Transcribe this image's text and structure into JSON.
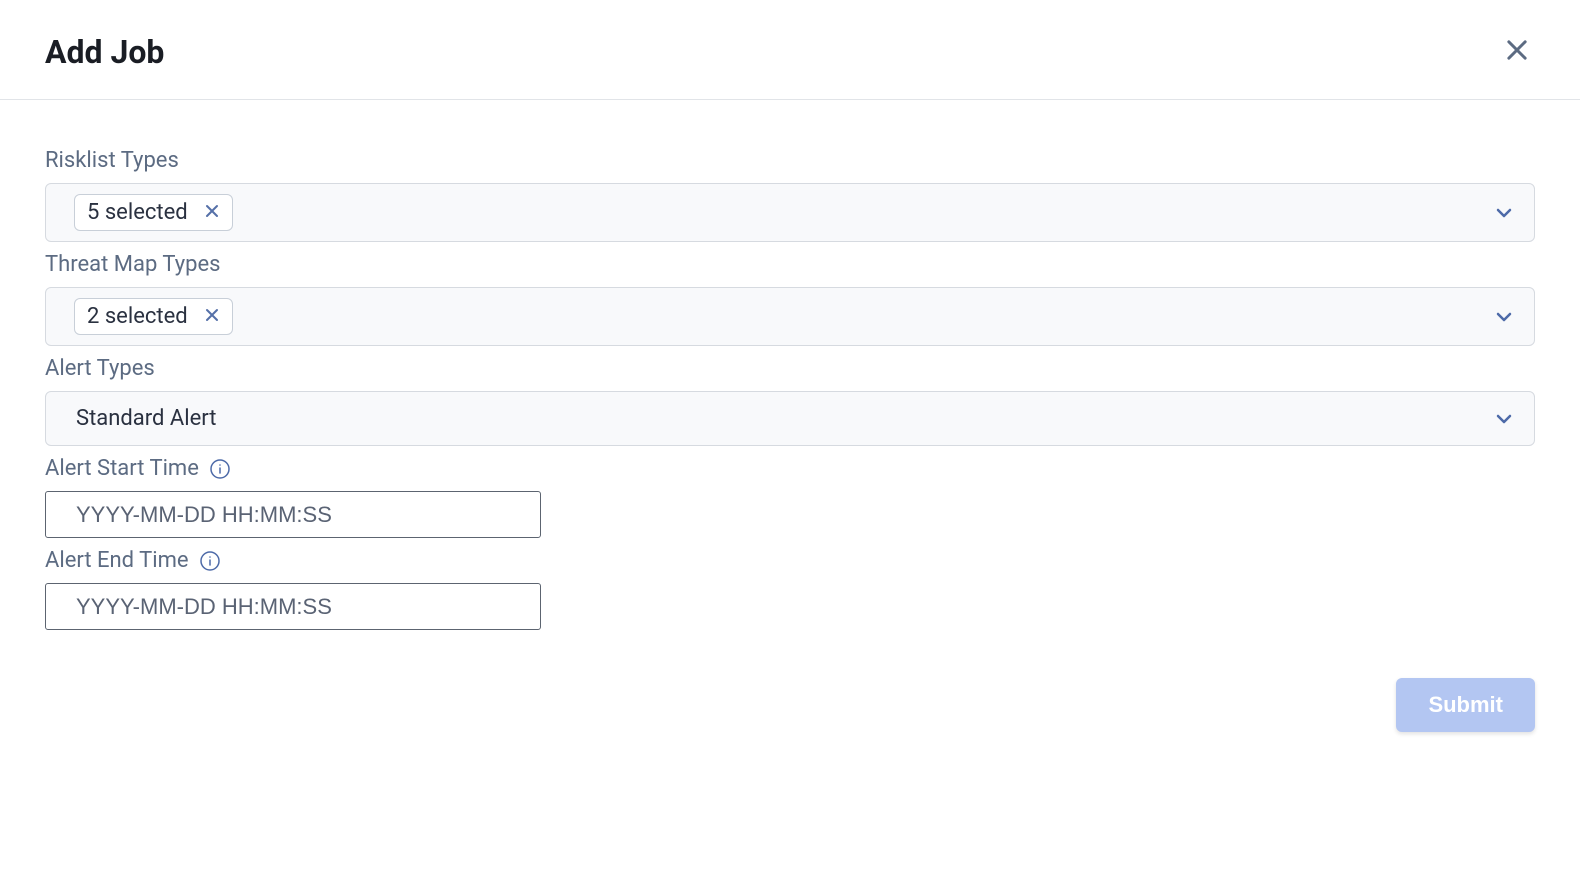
{
  "dialog": {
    "title": "Add Job"
  },
  "fields": {
    "risklist_types": {
      "label": "Risklist Types",
      "chip_text": "5 selected"
    },
    "threat_map_types": {
      "label": "Threat Map Types",
      "chip_text": "2 selected"
    },
    "alert_types": {
      "label": "Alert Types",
      "value": "Standard Alert"
    },
    "alert_start_time": {
      "label": "Alert Start Time",
      "placeholder": "YYYY-MM-DD HH:MM:SS"
    },
    "alert_end_time": {
      "label": "Alert End Time",
      "placeholder": "YYYY-MM-DD HH:MM:SS"
    }
  },
  "actions": {
    "submit_label": "Submit"
  },
  "colors": {
    "label_text": "#5c6b82",
    "input_bg": "#f8f9fb",
    "input_border": "#d6dae0",
    "text_border": "#5c6470",
    "submit_bg": "#b3c6f2",
    "chevron": "#4d6aa8",
    "info_icon": "#4d6aa8"
  }
}
